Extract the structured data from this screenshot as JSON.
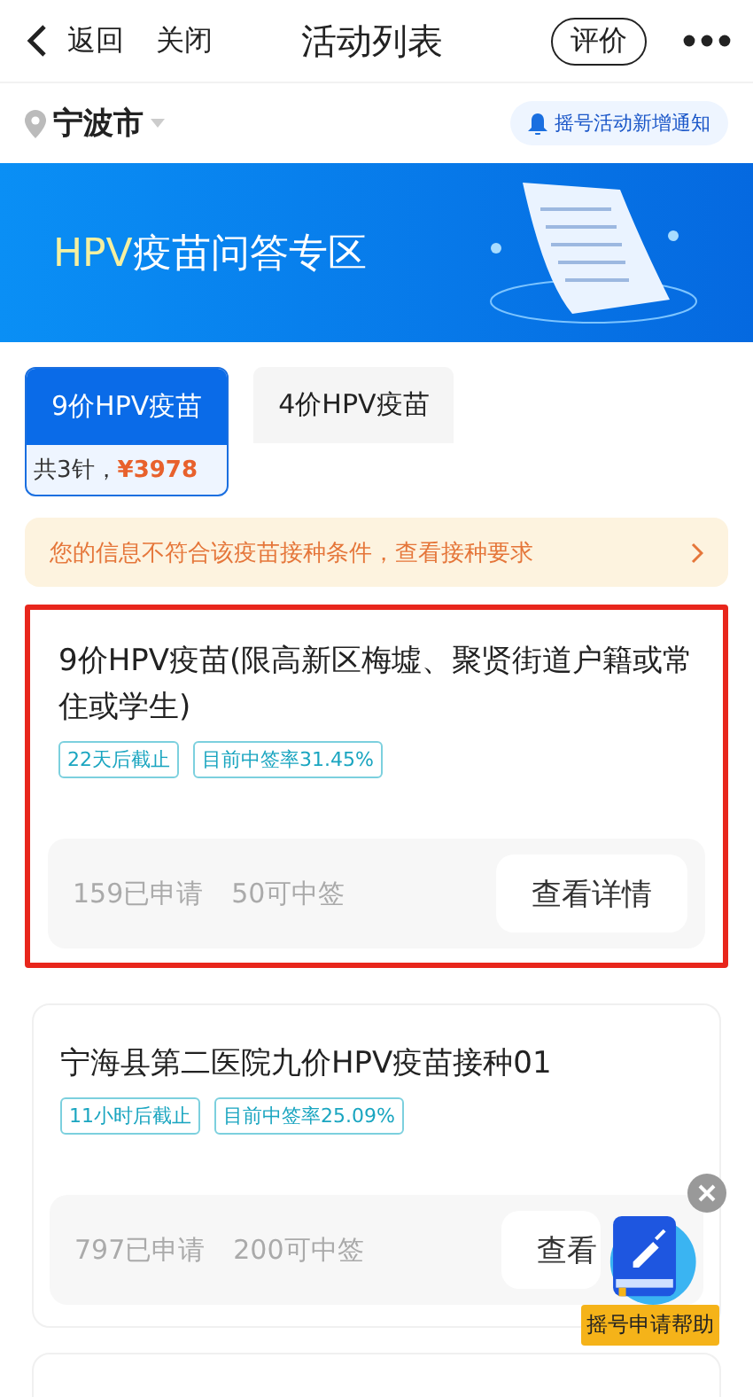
{
  "nav": {
    "back": "返回",
    "close": "关闭",
    "title": "活动列表",
    "rate": "评价"
  },
  "location": {
    "city": "宁波市",
    "notify": "摇号活动新增通知"
  },
  "banner": {
    "title_accent": "HPV",
    "title_rest": "疫苗问答专区"
  },
  "tabs": [
    {
      "label": "9价HPV疫苗",
      "selected": true,
      "detail": "共3针，",
      "price": "¥3978"
    },
    {
      "label": "4价HPV疫苗",
      "selected": false
    }
  ],
  "notice": "您的信息不符合该疫苗接种条件，查看接种要求",
  "cards": [
    {
      "title": "9价HPV疫苗(限高新区梅墟、聚贤街道户籍或常住或学生)",
      "highlighted": true,
      "tags": [
        "22天后截止",
        "目前中签率31.45%"
      ],
      "applied": "159已申请",
      "quota": "50可中签",
      "button": "查看详情"
    },
    {
      "title": "宁海县第二医院九价HPV疫苗接种01",
      "highlighted": false,
      "tags": [
        "11小时后截止",
        "目前中签率25.09%"
      ],
      "applied": "797已申请",
      "quota": "200可中签",
      "button": "查看"
    }
  ],
  "helper": {
    "label": "摇号申请帮助"
  }
}
